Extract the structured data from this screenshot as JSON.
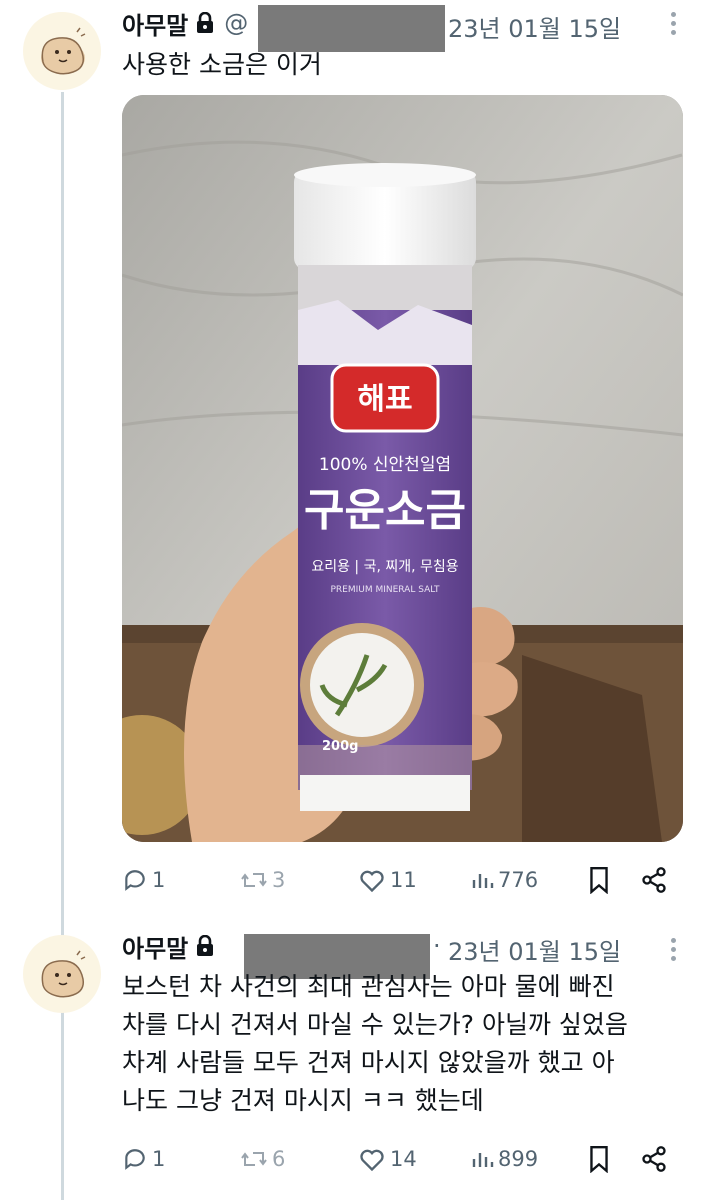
{
  "tweets": [
    {
      "author_name": "아무말",
      "handle_prefix": "@",
      "date": "23년 01월 15일",
      "text_lines": [
        "사용한 소금은 이거"
      ],
      "media": {
        "brand": "해표",
        "subtitle": "100% 신안천일염",
        "product": "구운소금",
        "usage": "요리용 | 국, 찌개, 무침용",
        "english": "PREMIUM MINERAL SALT",
        "weight": "200g"
      },
      "stats": {
        "replies": "1",
        "retweets": "3",
        "likes": "11",
        "views": "776"
      }
    },
    {
      "author_name": "아무말",
      "separator": "·",
      "date": "23년 01월 15일",
      "text_lines": [
        "보스턴 차 사건의 최대 관심사는 아마 물에 빠진",
        "차를 다시 건져서 마실 수 있는가? 아닐까 싶었음",
        "차계 사람들 모두 건져 마시지 않았을까 했고 아",
        "나도 그냥 건져 마시지 ㅋㅋ 했는데"
      ],
      "stats": {
        "replies": "1",
        "retweets": "6",
        "likes": "14",
        "views": "899"
      }
    }
  ],
  "colors": {
    "text": "#0f1419",
    "secondary": "#536471",
    "thread": "#cfd9de",
    "package": "#6b4f9a",
    "brand_red": "#d42a2a"
  },
  "icons": [
    "lock-icon",
    "reply-icon",
    "retweet-icon",
    "like-icon",
    "views-icon",
    "bookmark-icon",
    "share-icon",
    "more-icon"
  ]
}
